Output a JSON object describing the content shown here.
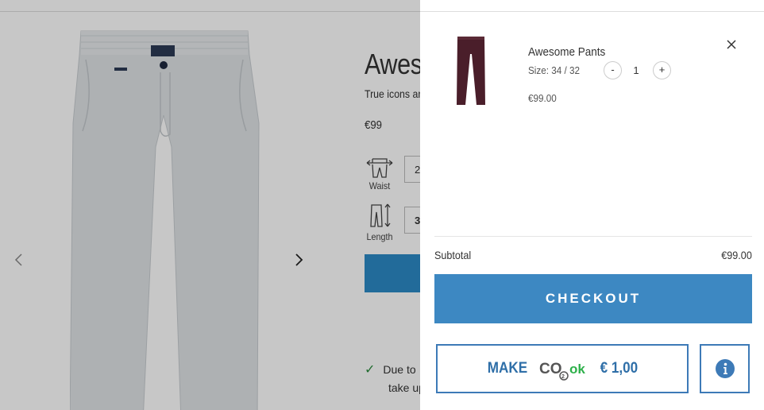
{
  "background_page": {
    "title_partial": "Aweso",
    "subtitle_partial": "True icons ar",
    "price": "€99",
    "waist": {
      "label": "Waist",
      "value_partial": "2"
    },
    "length": {
      "label": "Length",
      "value_partial": "3"
    },
    "note_line1": "Due to",
    "note_line2": "take up",
    "prev_icon": "chevron-left-icon",
    "next_icon": "chevron-right-icon"
  },
  "cart": {
    "item": {
      "name": "Awesome Pants",
      "size": "Size: 34 / 32",
      "quantity": "1",
      "price": "€99.00",
      "minus_label": "-",
      "plus_label": "+"
    },
    "subtotal_label": "Subtotal",
    "subtotal_value": "€99.00",
    "checkout_label": "CHECKOUT",
    "co2": {
      "make_label": "MAKE",
      "logo_text": "CO2ok",
      "amount": "€ 1,00"
    }
  },
  "colors": {
    "accent": "#3d88c2",
    "co2_border": "#3d7ab7",
    "co2_green": "#2db04a",
    "item_color": "#4a1e2a"
  }
}
